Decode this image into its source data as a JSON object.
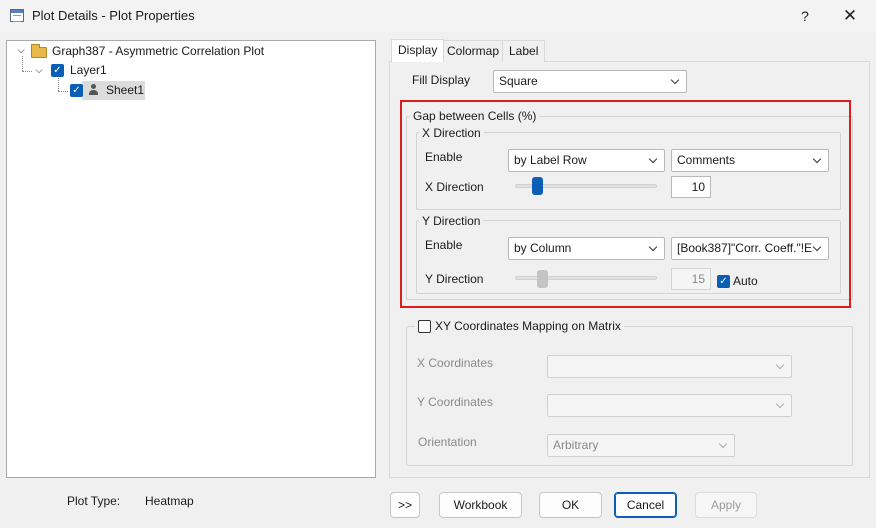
{
  "window": {
    "title": "Plot Details - Plot Properties",
    "help_label": "?",
    "close_label": "✕"
  },
  "tree": {
    "graph": {
      "label": "Graph387 - Asymmetric Correlation Plot"
    },
    "layer": {
      "label": "Layer1",
      "checked": true
    },
    "sheet": {
      "label": "Sheet1",
      "checked": true
    }
  },
  "plot_type": {
    "label": "Plot Type:",
    "value": "Heatmap"
  },
  "tabs": [
    {
      "label": "Display",
      "active": true
    },
    {
      "label": "Colormap",
      "active": false
    },
    {
      "label": "Label",
      "active": false
    }
  ],
  "display": {
    "fill_display_label": "Fill Display",
    "fill_display_value": "Square",
    "gap_group_title": "Gap between Cells (%)",
    "x_direction": {
      "group_title": "X Direction",
      "enable_label": "Enable",
      "enable_value": "by Label Row",
      "source_value": "Comments",
      "slider_label": "X Direction",
      "value": "10",
      "slider_fraction": 0.13
    },
    "y_direction": {
      "group_title": "Y Direction",
      "enable_label": "Enable",
      "enable_value": "by Column",
      "source_value": "[Book387]\"Corr. Coeff.\"!E",
      "slider_label": "Y Direction",
      "value": "15",
      "slider_fraction": 0.17,
      "auto_label": "Auto",
      "auto_checked": true
    },
    "xy_mapping": {
      "title": "XY Coordinates Mapping on Matrix",
      "checked": false,
      "x_coordinates_label": "X Coordinates",
      "x_coordinates_value": "",
      "y_coordinates_label": "Y Coordinates",
      "y_coordinates_value": "",
      "orientation_label": "Orientation",
      "orientation_value": "Arbitrary"
    }
  },
  "buttons": {
    "expand": ">>",
    "workbook": "Workbook",
    "ok": "OK",
    "cancel": "Cancel",
    "apply": "Apply"
  },
  "colors": {
    "accent": "#0a5fb4",
    "highlight_box": "#d81e1e"
  }
}
